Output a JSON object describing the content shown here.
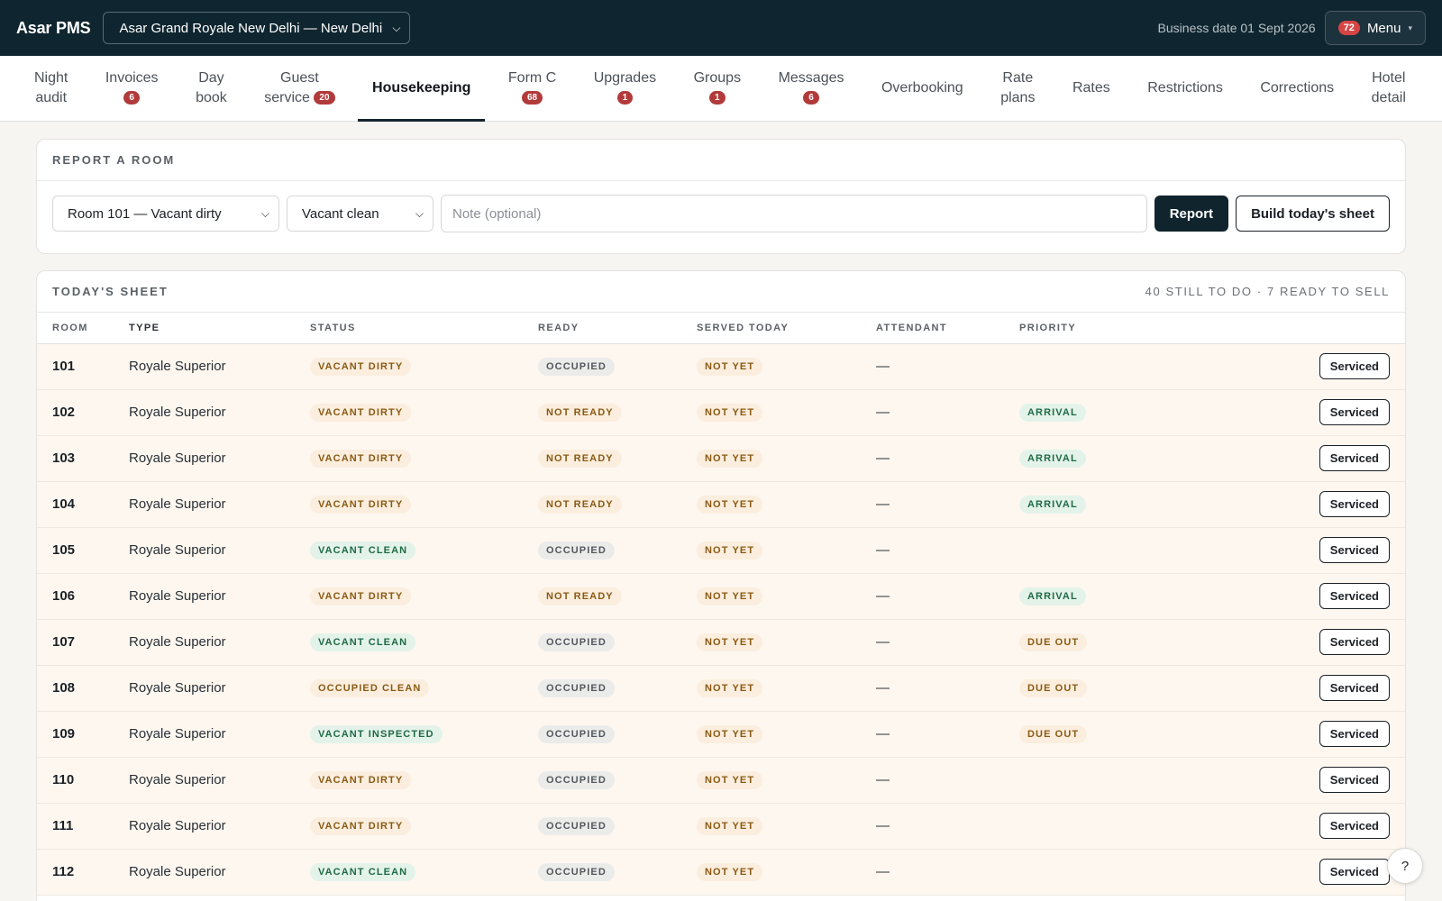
{
  "app": {
    "brand": "Asar PMS"
  },
  "header": {
    "hotel_select": "Asar Grand Royale New Delhi — New Delhi",
    "business_date": "Business date 01 Sept 2026",
    "menu": {
      "badge": "72",
      "label": "Menu"
    }
  },
  "nav": {
    "items": [
      {
        "line1": "Night",
        "line2": "audit",
        "badge": ""
      },
      {
        "line1": "Invoices",
        "line2": "",
        "badge": "6"
      },
      {
        "line1": "Day",
        "line2": "book",
        "badge": ""
      },
      {
        "line1": "Guest",
        "line2": "service",
        "badge": "20"
      },
      {
        "line1": "Housekeeping",
        "line2": "",
        "badge": ""
      },
      {
        "line1": "Form C",
        "line2": "",
        "badge": "68"
      },
      {
        "line1": "Upgrades",
        "line2": "",
        "badge": "1"
      },
      {
        "line1": "Groups",
        "line2": "",
        "badge": "1"
      },
      {
        "line1": "Messages",
        "line2": "",
        "badge": "6"
      },
      {
        "line1": "Overbooking",
        "line2": "",
        "badge": ""
      },
      {
        "line1": "Rate",
        "line2": "plans",
        "badge": ""
      },
      {
        "line1": "Rates",
        "line2": "",
        "badge": ""
      },
      {
        "line1": "Restrictions",
        "line2": "",
        "badge": ""
      },
      {
        "line1": "Corrections",
        "line2": "",
        "badge": ""
      },
      {
        "line1": "Hotel",
        "line2": "detail",
        "badge": ""
      }
    ],
    "active": "Housekeeping"
  },
  "report": {
    "title": "REPORT A ROOM",
    "room_select": "Room 101 — Vacant dirty",
    "status_select": "Vacant clean",
    "note_placeholder": "Note (optional)",
    "report_button": "Report",
    "build_button": "Build today's sheet"
  },
  "sheet": {
    "title": "TODAY'S SHEET",
    "summary": "40 STILL TO DO · 7 READY TO SELL",
    "columns": [
      "ROOM",
      "TYPE",
      "STATUS",
      "READY",
      "SERVED TODAY",
      "ATTENDANT",
      "PRIORITY"
    ],
    "action_label": "Serviced",
    "rows": [
      {
        "room": "101",
        "type": "Royale Superior",
        "status": "VACANT DIRTY",
        "ready": "OCCUPIED",
        "served": "NOT YET",
        "attendant": "—",
        "priority": ""
      },
      {
        "room": "102",
        "type": "Royale Superior",
        "status": "VACANT DIRTY",
        "ready": "NOT READY",
        "served": "NOT YET",
        "attendant": "—",
        "priority": "ARRIVAL"
      },
      {
        "room": "103",
        "type": "Royale Superior",
        "status": "VACANT DIRTY",
        "ready": "NOT READY",
        "served": "NOT YET",
        "attendant": "—",
        "priority": "ARRIVAL"
      },
      {
        "room": "104",
        "type": "Royale Superior",
        "status": "VACANT DIRTY",
        "ready": "NOT READY",
        "served": "NOT YET",
        "attendant": "—",
        "priority": "ARRIVAL"
      },
      {
        "room": "105",
        "type": "Royale Superior",
        "status": "VACANT CLEAN",
        "ready": "OCCUPIED",
        "served": "NOT YET",
        "attendant": "—",
        "priority": ""
      },
      {
        "room": "106",
        "type": "Royale Superior",
        "status": "VACANT DIRTY",
        "ready": "NOT READY",
        "served": "NOT YET",
        "attendant": "—",
        "priority": "ARRIVAL"
      },
      {
        "room": "107",
        "type": "Royale Superior",
        "status": "VACANT CLEAN",
        "ready": "OCCUPIED",
        "served": "NOT YET",
        "attendant": "—",
        "priority": "DUE OUT"
      },
      {
        "room": "108",
        "type": "Royale Superior",
        "status": "OCCUPIED CLEAN",
        "ready": "OCCUPIED",
        "served": "NOT YET",
        "attendant": "—",
        "priority": "DUE OUT"
      },
      {
        "room": "109",
        "type": "Royale Superior",
        "status": "VACANT INSPECTED",
        "ready": "OCCUPIED",
        "served": "NOT YET",
        "attendant": "—",
        "priority": "DUE OUT"
      },
      {
        "room": "110",
        "type": "Royale Superior",
        "status": "VACANT DIRTY",
        "ready": "OCCUPIED",
        "served": "NOT YET",
        "attendant": "—",
        "priority": ""
      },
      {
        "room": "111",
        "type": "Royale Superior",
        "status": "VACANT DIRTY",
        "ready": "OCCUPIED",
        "served": "NOT YET",
        "attendant": "—",
        "priority": ""
      },
      {
        "room": "112",
        "type": "Royale Superior",
        "status": "VACANT CLEAN",
        "ready": "OCCUPIED",
        "served": "NOT YET",
        "attendant": "—",
        "priority": ""
      }
    ]
  },
  "help_label": "?"
}
